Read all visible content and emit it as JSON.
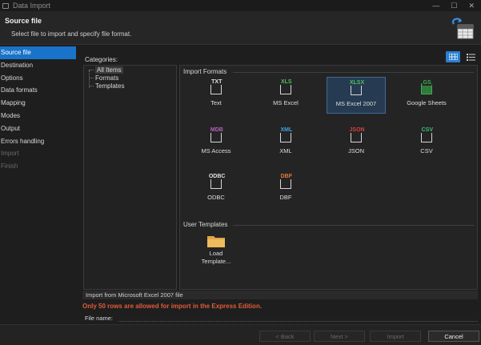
{
  "window": {
    "title": "Data Import",
    "controls": [
      "—",
      "☐",
      "✕"
    ]
  },
  "header": {
    "title": "Source file",
    "subtitle": "Select file to import and specify file format."
  },
  "sidebar": {
    "items": [
      {
        "label": "Source file",
        "state": "active"
      },
      {
        "label": "Destination",
        "state": "normal"
      },
      {
        "label": "Options",
        "state": "normal"
      },
      {
        "label": "Data formats",
        "state": "normal"
      },
      {
        "label": "Mapping",
        "state": "normal"
      },
      {
        "label": "Modes",
        "state": "normal"
      },
      {
        "label": "Output",
        "state": "normal"
      },
      {
        "label": "Errors handling",
        "state": "normal"
      },
      {
        "label": "Import",
        "state": "disabled"
      },
      {
        "label": "Finish",
        "state": "disabled"
      }
    ]
  },
  "categories": {
    "label": "Categories:",
    "items": [
      {
        "label": "All Items",
        "selected": true
      },
      {
        "label": "Formats",
        "selected": false
      },
      {
        "label": "Templates",
        "selected": false
      }
    ]
  },
  "view_toggle": {
    "active": "large-icons"
  },
  "import_formats": {
    "heading": "Import Formats",
    "items": [
      {
        "tag": "TXT",
        "tag_color": "#e0e0e0",
        "label": "Text",
        "selected": false
      },
      {
        "tag": "XLS",
        "tag_color": "#4fbf5a",
        "label": "MS Excel",
        "selected": false
      },
      {
        "tag": "XLSX",
        "tag_color": "#4fbf5a",
        "label": "MS Excel 2007",
        "selected": true
      },
      {
        "tag": "GS",
        "tag_color": "#3fae52",
        "label": "Google Sheets",
        "selected": false
      },
      {
        "tag": "MDB",
        "tag_color": "#b45fc0",
        "label": "MS Access",
        "selected": false
      },
      {
        "tag": "XML",
        "tag_color": "#3fa2e0",
        "label": "XML",
        "selected": false
      },
      {
        "tag": "JSON",
        "tag_color": "#d94040",
        "label": "JSON",
        "selected": false
      },
      {
        "tag": "CSV",
        "tag_color": "#3fbf7a",
        "label": "CSV",
        "selected": false
      },
      {
        "tag": "ODBC",
        "tag_color": "#e0e0e0",
        "label": "ODBC",
        "selected": false
      },
      {
        "tag": "DBF",
        "tag_color": "#e07a3a",
        "label": "DBF",
        "selected": false
      }
    ]
  },
  "user_templates": {
    "heading": "User Templates",
    "items": [
      {
        "label_line1": "Load",
        "label_line2": "Template..."
      }
    ]
  },
  "status": {
    "description": "Import from Microsoft Excel 2007 file",
    "warning": "Only 50 rows are allowed for import in the Express Edition.",
    "warning_color": "#e25b3a"
  },
  "file": {
    "label": "File name:",
    "value": ""
  },
  "footer": {
    "back": "< Back",
    "next": "Next >",
    "import": "Import",
    "cancel": "Cancel"
  },
  "colors": {
    "accent": "#1873c9",
    "background": "#1e1e1e"
  }
}
